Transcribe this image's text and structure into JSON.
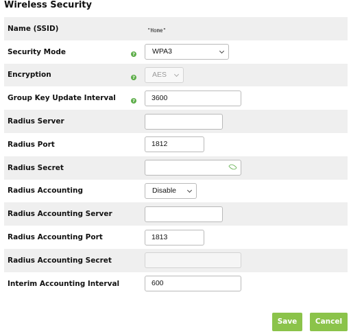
{
  "page": {
    "title": "Wireless Security"
  },
  "rows": {
    "ssid": {
      "label": "Name (SSID)",
      "value": "\"Home\""
    },
    "security_mode": {
      "label": "Security Mode",
      "value": "WPA3"
    },
    "encryption": {
      "label": "Encryption",
      "value": "AES"
    },
    "group_key": {
      "label": "Group Key Update Interval",
      "value": "3600"
    },
    "radius_server": {
      "label": "Radius Server",
      "value": ""
    },
    "radius_port": {
      "label": "Radius Port",
      "value": "1812"
    },
    "radius_secret": {
      "label": "Radius Secret",
      "value": ""
    },
    "radius_accounting": {
      "label": "Radius Accounting",
      "value": "Disable"
    },
    "radius_acct_server": {
      "label": "Radius Accounting Server",
      "value": ""
    },
    "radius_acct_port": {
      "label": "Radius Accounting Port",
      "value": "1813"
    },
    "radius_acct_secret": {
      "label": "Radius Accounting Secret",
      "value": ""
    },
    "interim_interval": {
      "label": "Interim Accounting Interval",
      "value": "600"
    }
  },
  "help_icon": {
    "glyph": "?",
    "color": "#5cad48"
  },
  "buttons": {
    "save": "Save",
    "cancel": "Cancel",
    "color": "#8bc34a"
  }
}
